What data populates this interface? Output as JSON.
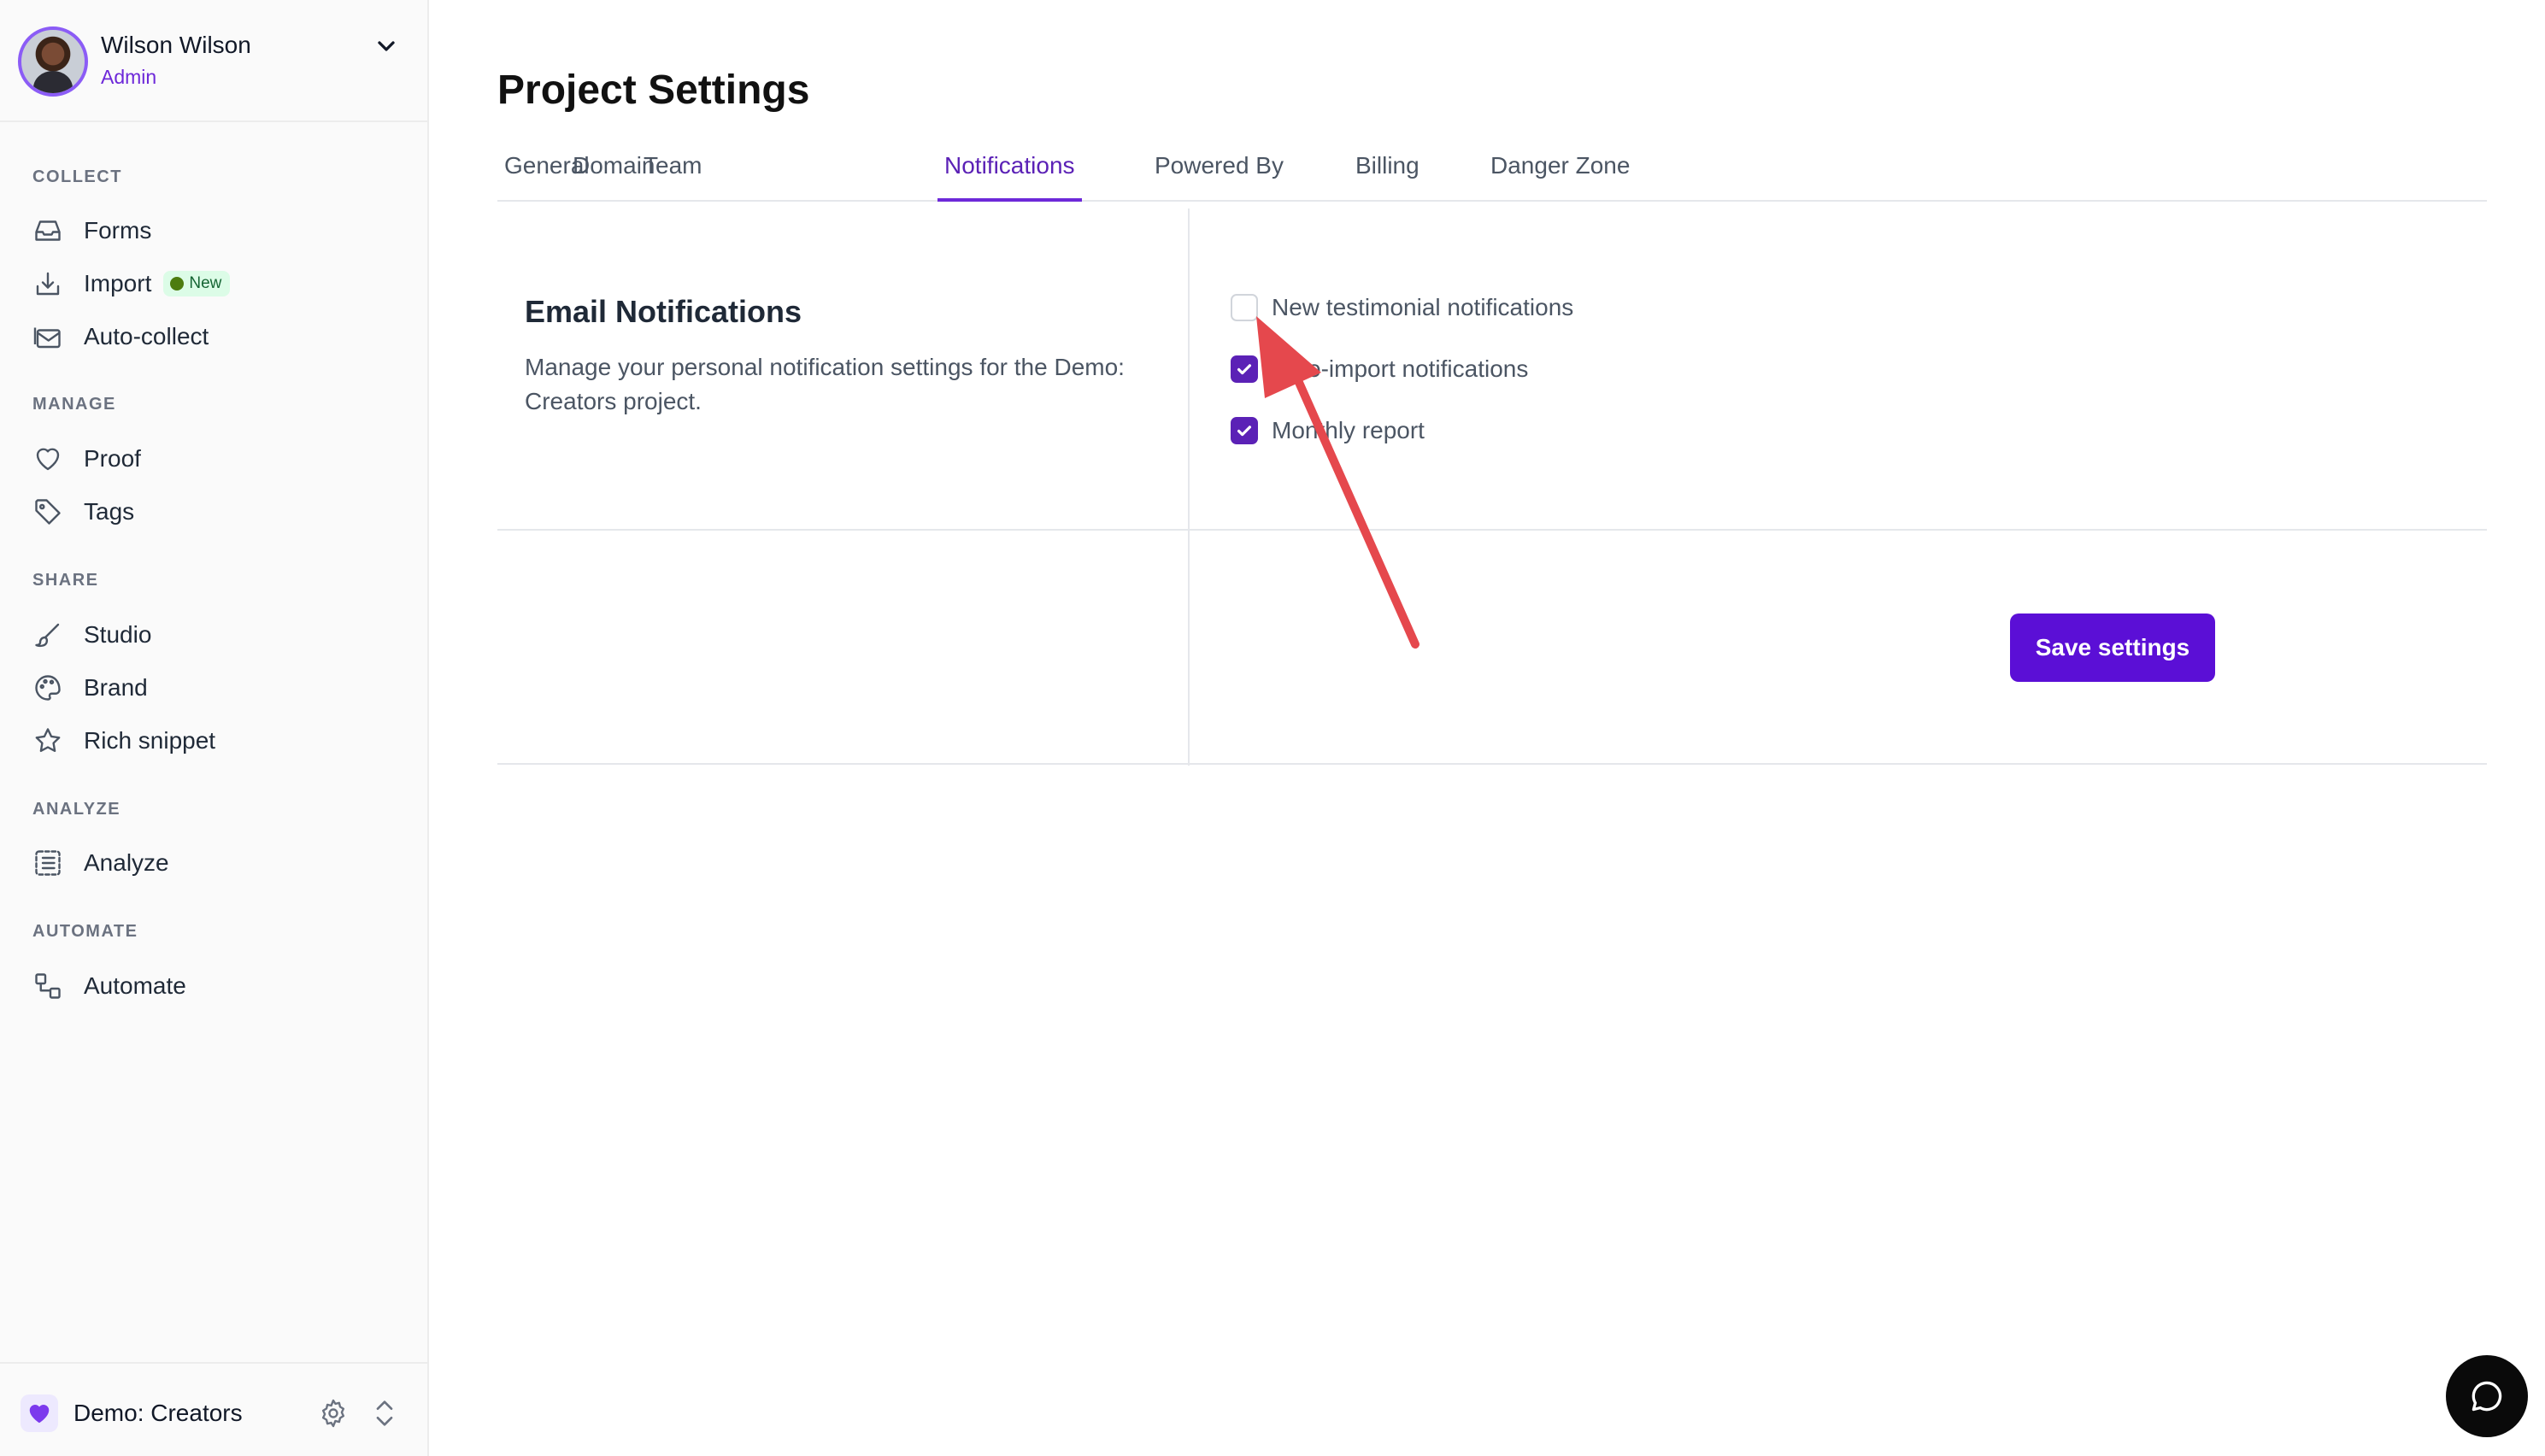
{
  "user": {
    "name": "Wilson Wilson",
    "role": "Admin"
  },
  "sidebar": {
    "sections": [
      {
        "label": "COLLECT",
        "items": [
          {
            "label": "Forms",
            "icon": "inbox-icon"
          },
          {
            "label": "Import",
            "icon": "import-icon",
            "badge": "New"
          },
          {
            "label": "Auto-collect",
            "icon": "mail-stack-icon"
          }
        ]
      },
      {
        "label": "MANAGE",
        "items": [
          {
            "label": "Proof",
            "icon": "heart-icon"
          },
          {
            "label": "Tags",
            "icon": "tag-icon"
          }
        ]
      },
      {
        "label": "SHARE",
        "items": [
          {
            "label": "Studio",
            "icon": "brush-icon"
          },
          {
            "label": "Brand",
            "icon": "palette-icon"
          },
          {
            "label": "Rich snippet",
            "icon": "star-icon"
          }
        ]
      },
      {
        "label": "ANALYZE",
        "items": [
          {
            "label": "Analyze",
            "icon": "list-icon"
          }
        ]
      },
      {
        "label": "AUTOMATE",
        "items": [
          {
            "label": "Automate",
            "icon": "workflow-icon"
          }
        ]
      }
    ]
  },
  "project": {
    "name": "Demo: Creators"
  },
  "page": {
    "title": "Project Settings",
    "tabs": [
      {
        "label": "General",
        "active": false
      },
      {
        "label": "Domain",
        "active": false
      },
      {
        "label": "Team",
        "active": false
      },
      {
        "label": "Notifications",
        "active": true
      },
      {
        "label": "Powered By",
        "active": false
      },
      {
        "label": "Billing",
        "active": false
      },
      {
        "label": "Danger Zone",
        "active": false
      }
    ]
  },
  "email_notifications": {
    "title": "Email Notifications",
    "description": "Manage your personal notification settings for the Demo: Creators project.",
    "options": [
      {
        "label": "New testimonial notifications",
        "checked": false
      },
      {
        "label": "Auto-import notifications",
        "checked": true
      },
      {
        "label": "Monthly report",
        "checked": true
      }
    ]
  },
  "actions": {
    "save_label": "Save settings"
  },
  "colors": {
    "accent": "#5b21b6",
    "button": "#5b0fd6",
    "annotation_arrow": "#e5484d",
    "badge_bg": "#dcfce7"
  }
}
